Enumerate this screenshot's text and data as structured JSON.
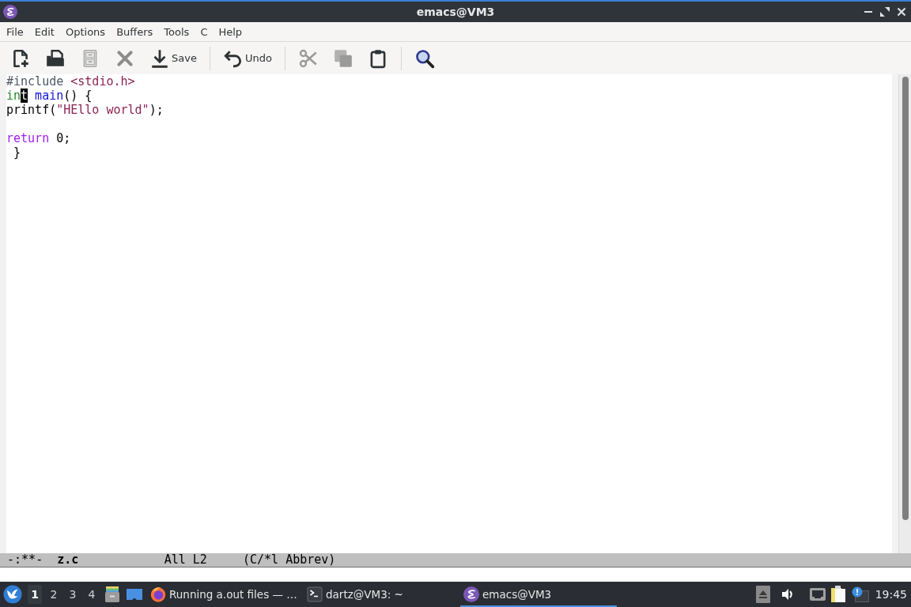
{
  "window": {
    "title": "emacs@VM3"
  },
  "menu": [
    {
      "label": "File"
    },
    {
      "label": "Edit"
    },
    {
      "label": "Options"
    },
    {
      "label": "Buffers"
    },
    {
      "label": "Tools"
    },
    {
      "label": "C"
    },
    {
      "label": "Help"
    }
  ],
  "toolbar": [
    {
      "buttons": [
        {
          "kind": "new",
          "disabled": false
        },
        {
          "kind": "open",
          "disabled": false
        },
        {
          "kind": "directory",
          "disabled": false
        },
        {
          "kind": "close",
          "disabled": false
        },
        {
          "kind": "write",
          "label": "Save",
          "disabled": false
        }
      ]
    },
    {
      "buttons": [
        {
          "kind": "undo",
          "label": "Undo",
          "disabled": false
        }
      ]
    },
    {
      "buttons": [
        {
          "kind": "cut",
          "disabled": true
        },
        {
          "kind": "copy",
          "disabled": true
        },
        {
          "kind": "paste",
          "disabled": false
        }
      ]
    },
    {
      "buttons": [
        {
          "kind": "search",
          "disabled": false
        }
      ]
    }
  ],
  "editor": {
    "lines": [
      {
        "kind": "code",
        "tokens": [
          {
            "text": "#include",
            "kind": "preprocessor",
            "cursor": false
          },
          {
            "text": " <stdio.h>",
            "kind": "string",
            "cursor": false
          }
        ]
      },
      {
        "kind": "code",
        "tokens": [
          {
            "text": "in",
            "kind": "type",
            "cursor": false
          },
          {
            "text": "t",
            "kind": "type",
            "cursor": true
          },
          {
            "text": " main",
            "kind": "function",
            "cursor": false
          },
          {
            "text": "() {",
            "kind": "plain",
            "cursor": false
          }
        ]
      },
      {
        "kind": "code",
        "tokens": [
          {
            "text": "printf(",
            "kind": "plain",
            "cursor": false
          },
          {
            "text": "\"HEllo world\"",
            "kind": "string",
            "cursor": false
          },
          {
            "text": ");",
            "kind": "plain",
            "cursor": false
          }
        ]
      },
      {
        "kind": "blank"
      },
      {
        "kind": "code",
        "tokens": [
          {
            "text": "return",
            "kind": "keyword",
            "cursor": false
          },
          {
            "text": " 0;",
            "kind": "plain",
            "cursor": false
          }
        ]
      },
      {
        "kind": "code",
        "tokens": [
          {
            "text": " }",
            "kind": "plain",
            "cursor": false
          }
        ]
      }
    ]
  },
  "mode_line": {
    "flags": "-:**-",
    "buffer": "z.c",
    "position": "All L2",
    "modes": "(C/*l Abbrev)"
  },
  "taskbar": {
    "workspaces": [
      {
        "label": "1",
        "selected": true
      },
      {
        "label": "2",
        "selected": false
      },
      {
        "label": "3",
        "selected": false
      },
      {
        "label": "4",
        "selected": false
      }
    ],
    "tasks": [
      {
        "kind": "browser",
        "label": "Running a.out files — …",
        "selected": false
      },
      {
        "kind": "terminal",
        "label": "dartz@VM3: ~",
        "selected": false
      },
      {
        "kind": "editor",
        "label": "emacs@VM3",
        "selected": true
      }
    ],
    "clock": "19:45"
  }
}
